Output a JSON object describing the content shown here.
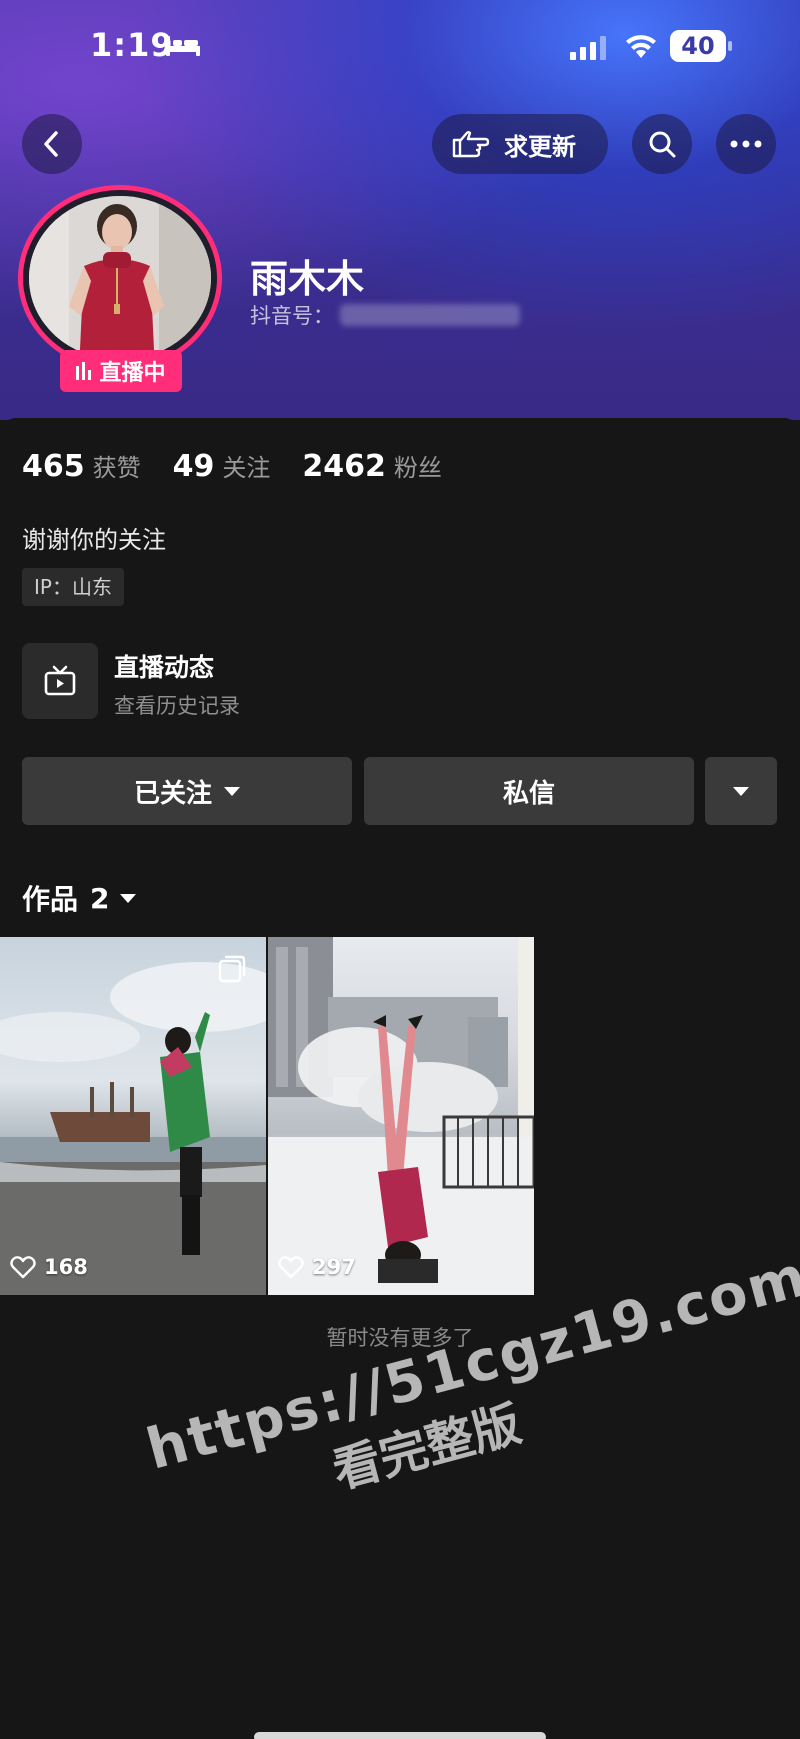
{
  "status_bar": {
    "time": "1:19",
    "battery": "40"
  },
  "header": {
    "request_update_label": "求更新"
  },
  "profile": {
    "nickname": "雨木木",
    "douyin_id_label": "抖音号：",
    "live_badge": "直播中"
  },
  "stats": [
    {
      "value": "465",
      "label": "获赞"
    },
    {
      "value": "49",
      "label": "关注"
    },
    {
      "value": "2462",
      "label": "粉丝"
    }
  ],
  "bio": "谢谢你的关注",
  "ip_tag": "IP：山东",
  "live_history": {
    "title": "直播动态",
    "subtitle": "查看历史记录"
  },
  "actions": {
    "follow_label": "已关注",
    "message_label": "私信"
  },
  "works": {
    "label": "作品",
    "count": "2",
    "items": [
      {
        "likes": "168"
      },
      {
        "likes": "297"
      }
    ],
    "end_text": "暂时没有更多了"
  },
  "watermark": {
    "url": "https://51cgz19.com",
    "text": "看完整版"
  },
  "colors": {
    "accent_pink": "#ff2d7a",
    "panel_bg": "#161616",
    "button_bg": "#3a3a3a"
  }
}
